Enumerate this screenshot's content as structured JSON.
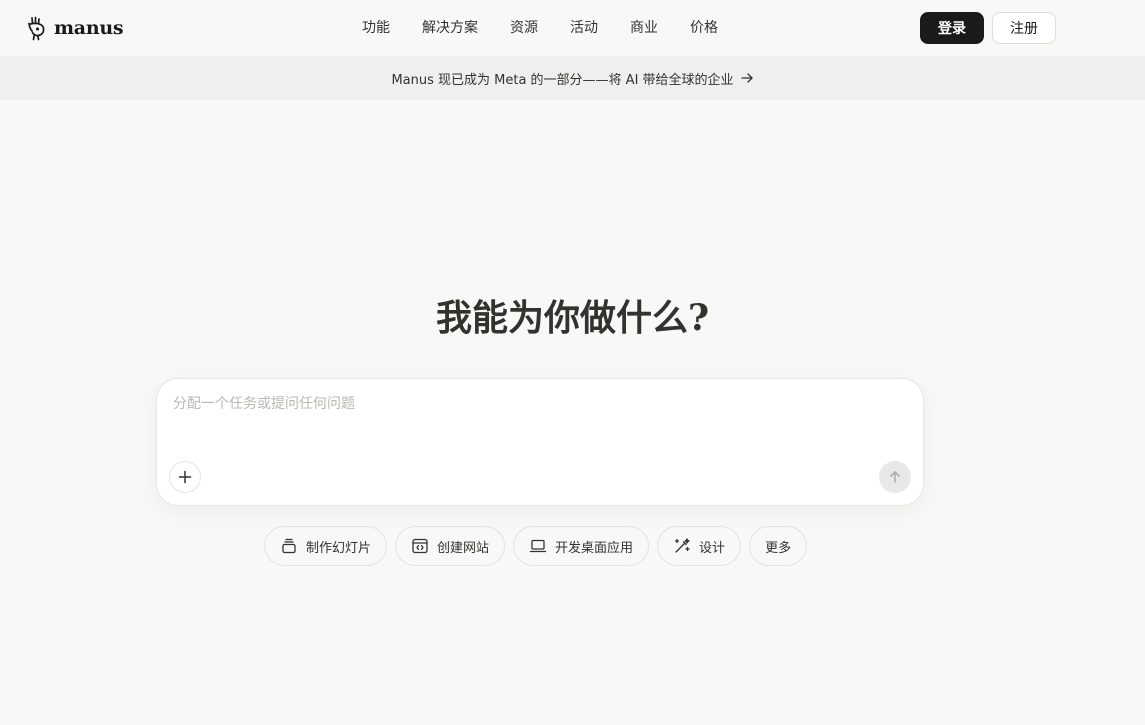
{
  "brand": {
    "name": "manus",
    "logo_icon": "manus-hand-icon"
  },
  "nav": {
    "items": [
      {
        "label": "功能"
      },
      {
        "label": "解决方案"
      },
      {
        "label": "资源"
      },
      {
        "label": "活动"
      },
      {
        "label": "商业"
      },
      {
        "label": "价格"
      }
    ]
  },
  "auth": {
    "login_label": "登录",
    "signup_label": "注册"
  },
  "banner": {
    "text": "Manus 现已成为 Meta 的一部分——将 AI 带给全球的企业",
    "icon": "arrow-right-icon"
  },
  "hero": {
    "title": "我能为你做什么?"
  },
  "composer": {
    "placeholder": "分配一个任务或提问任何问题",
    "value": "",
    "attach_icon": "plus-icon",
    "send_icon": "arrow-up-icon"
  },
  "quick_actions": [
    {
      "label": "制作幻灯片",
      "icon": "slides-icon"
    },
    {
      "label": "创建网站",
      "icon": "website-icon"
    },
    {
      "label": "开发桌面应用",
      "icon": "laptop-icon"
    },
    {
      "label": "设计",
      "icon": "magic-wand-icon"
    },
    {
      "label": "更多",
      "icon": ""
    }
  ],
  "colors": {
    "background": "#f8f8f7",
    "banner_bg": "#efefed",
    "primary_button": "#1a1a19",
    "text": "#34322d",
    "placeholder": "#b9b8b4",
    "send_disabled": "#e8e8e6"
  }
}
